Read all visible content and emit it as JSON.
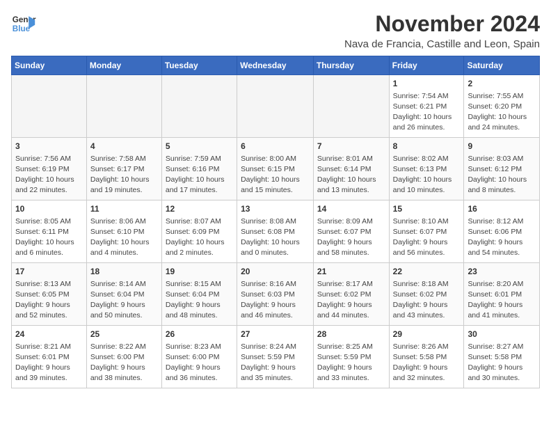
{
  "logo": {
    "line1": "General",
    "line2": "Blue"
  },
  "title": "November 2024",
  "subtitle": "Nava de Francia, Castille and Leon, Spain",
  "weekdays": [
    "Sunday",
    "Monday",
    "Tuesday",
    "Wednesday",
    "Thursday",
    "Friday",
    "Saturday"
  ],
  "weeks": [
    [
      {
        "day": "",
        "info": ""
      },
      {
        "day": "",
        "info": ""
      },
      {
        "day": "",
        "info": ""
      },
      {
        "day": "",
        "info": ""
      },
      {
        "day": "",
        "info": ""
      },
      {
        "day": "1",
        "info": "Sunrise: 7:54 AM\nSunset: 6:21 PM\nDaylight: 10 hours and 26 minutes."
      },
      {
        "day": "2",
        "info": "Sunrise: 7:55 AM\nSunset: 6:20 PM\nDaylight: 10 hours and 24 minutes."
      }
    ],
    [
      {
        "day": "3",
        "info": "Sunrise: 7:56 AM\nSunset: 6:19 PM\nDaylight: 10 hours and 22 minutes."
      },
      {
        "day": "4",
        "info": "Sunrise: 7:58 AM\nSunset: 6:17 PM\nDaylight: 10 hours and 19 minutes."
      },
      {
        "day": "5",
        "info": "Sunrise: 7:59 AM\nSunset: 6:16 PM\nDaylight: 10 hours and 17 minutes."
      },
      {
        "day": "6",
        "info": "Sunrise: 8:00 AM\nSunset: 6:15 PM\nDaylight: 10 hours and 15 minutes."
      },
      {
        "day": "7",
        "info": "Sunrise: 8:01 AM\nSunset: 6:14 PM\nDaylight: 10 hours and 13 minutes."
      },
      {
        "day": "8",
        "info": "Sunrise: 8:02 AM\nSunset: 6:13 PM\nDaylight: 10 hours and 10 minutes."
      },
      {
        "day": "9",
        "info": "Sunrise: 8:03 AM\nSunset: 6:12 PM\nDaylight: 10 hours and 8 minutes."
      }
    ],
    [
      {
        "day": "10",
        "info": "Sunrise: 8:05 AM\nSunset: 6:11 PM\nDaylight: 10 hours and 6 minutes."
      },
      {
        "day": "11",
        "info": "Sunrise: 8:06 AM\nSunset: 6:10 PM\nDaylight: 10 hours and 4 minutes."
      },
      {
        "day": "12",
        "info": "Sunrise: 8:07 AM\nSunset: 6:09 PM\nDaylight: 10 hours and 2 minutes."
      },
      {
        "day": "13",
        "info": "Sunrise: 8:08 AM\nSunset: 6:08 PM\nDaylight: 10 hours and 0 minutes."
      },
      {
        "day": "14",
        "info": "Sunrise: 8:09 AM\nSunset: 6:07 PM\nDaylight: 9 hours and 58 minutes."
      },
      {
        "day": "15",
        "info": "Sunrise: 8:10 AM\nSunset: 6:07 PM\nDaylight: 9 hours and 56 minutes."
      },
      {
        "day": "16",
        "info": "Sunrise: 8:12 AM\nSunset: 6:06 PM\nDaylight: 9 hours and 54 minutes."
      }
    ],
    [
      {
        "day": "17",
        "info": "Sunrise: 8:13 AM\nSunset: 6:05 PM\nDaylight: 9 hours and 52 minutes."
      },
      {
        "day": "18",
        "info": "Sunrise: 8:14 AM\nSunset: 6:04 PM\nDaylight: 9 hours and 50 minutes."
      },
      {
        "day": "19",
        "info": "Sunrise: 8:15 AM\nSunset: 6:04 PM\nDaylight: 9 hours and 48 minutes."
      },
      {
        "day": "20",
        "info": "Sunrise: 8:16 AM\nSunset: 6:03 PM\nDaylight: 9 hours and 46 minutes."
      },
      {
        "day": "21",
        "info": "Sunrise: 8:17 AM\nSunset: 6:02 PM\nDaylight: 9 hours and 44 minutes."
      },
      {
        "day": "22",
        "info": "Sunrise: 8:18 AM\nSunset: 6:02 PM\nDaylight: 9 hours and 43 minutes."
      },
      {
        "day": "23",
        "info": "Sunrise: 8:20 AM\nSunset: 6:01 PM\nDaylight: 9 hours and 41 minutes."
      }
    ],
    [
      {
        "day": "24",
        "info": "Sunrise: 8:21 AM\nSunset: 6:01 PM\nDaylight: 9 hours and 39 minutes."
      },
      {
        "day": "25",
        "info": "Sunrise: 8:22 AM\nSunset: 6:00 PM\nDaylight: 9 hours and 38 minutes."
      },
      {
        "day": "26",
        "info": "Sunrise: 8:23 AM\nSunset: 6:00 PM\nDaylight: 9 hours and 36 minutes."
      },
      {
        "day": "27",
        "info": "Sunrise: 8:24 AM\nSunset: 5:59 PM\nDaylight: 9 hours and 35 minutes."
      },
      {
        "day": "28",
        "info": "Sunrise: 8:25 AM\nSunset: 5:59 PM\nDaylight: 9 hours and 33 minutes."
      },
      {
        "day": "29",
        "info": "Sunrise: 8:26 AM\nSunset: 5:58 PM\nDaylight: 9 hours and 32 minutes."
      },
      {
        "day": "30",
        "info": "Sunrise: 8:27 AM\nSunset: 5:58 PM\nDaylight: 9 hours and 30 minutes."
      }
    ]
  ]
}
